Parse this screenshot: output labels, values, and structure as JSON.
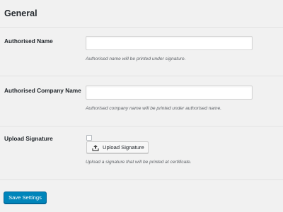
{
  "section": {
    "title": "General"
  },
  "fields": {
    "authorised_name": {
      "label": "Authorised Name",
      "value": "",
      "description": "Authorised name will be printed under signature."
    },
    "authorised_company_name": {
      "label": "Authorised Company Name",
      "value": "",
      "description": "Authorised company name will be printed under authorised name."
    },
    "upload_signature": {
      "label": "Upload Signature",
      "checked": false,
      "button_label": "Upload Signature",
      "button_icon": "upload-icon",
      "description": "Upload a signature that will be printed at certificate."
    }
  },
  "actions": {
    "save_label": "Save Settings"
  },
  "colors": {
    "primary": "#0085ba",
    "background": "#f1f1f1",
    "text": "#23282d",
    "description_text": "#5d6166"
  }
}
